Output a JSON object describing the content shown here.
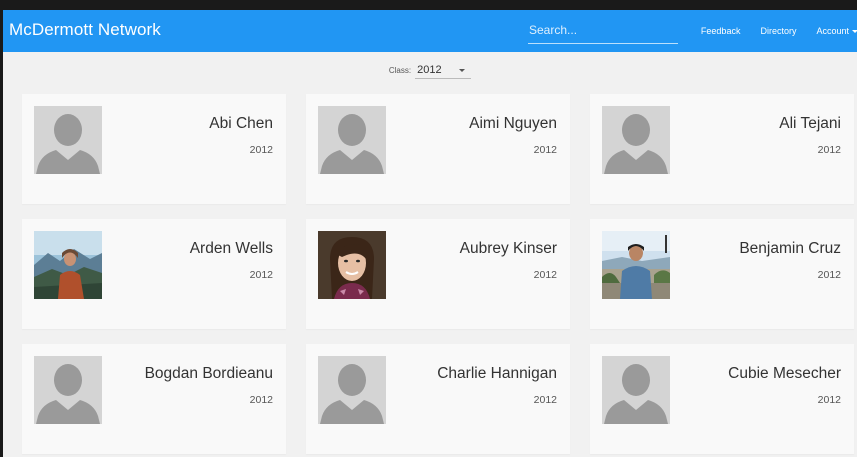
{
  "navbar": {
    "brand": "McDermott Network",
    "search_placeholder": "Search...",
    "links": [
      "Feedback",
      "Directory",
      "Account"
    ]
  },
  "filter": {
    "label": "Class:",
    "selected": "2012"
  },
  "people": [
    {
      "name": "Abi Chen",
      "year": "2012",
      "photo": "default-avatar-icon"
    },
    {
      "name": "Aimi Nguyen",
      "year": "2012",
      "photo": "default-avatar-icon"
    },
    {
      "name": "Ali Tejani",
      "year": "2012",
      "photo": "default-avatar-icon"
    },
    {
      "name": "Arden Wells",
      "year": "2012",
      "photo": "photo-mountain-scene"
    },
    {
      "name": "Aubrey Kinser",
      "year": "2012",
      "photo": "photo-portrait"
    },
    {
      "name": "Benjamin Cruz",
      "year": "2012",
      "photo": "photo-outdoor-waterfront"
    },
    {
      "name": "Bogdan Bordieanu",
      "year": "2012",
      "photo": "default-avatar-icon"
    },
    {
      "name": "Charlie Hannigan",
      "year": "2012",
      "photo": "default-avatar-icon"
    },
    {
      "name": "Cubie Mesecher",
      "year": "2012",
      "photo": "default-avatar-icon"
    }
  ],
  "colors": {
    "navbar": "#2196f3",
    "background": "#f1f1f1",
    "card": "#f9f9f9",
    "avatar_bg": "#d4d4d4",
    "avatar_fg": "#999999"
  }
}
